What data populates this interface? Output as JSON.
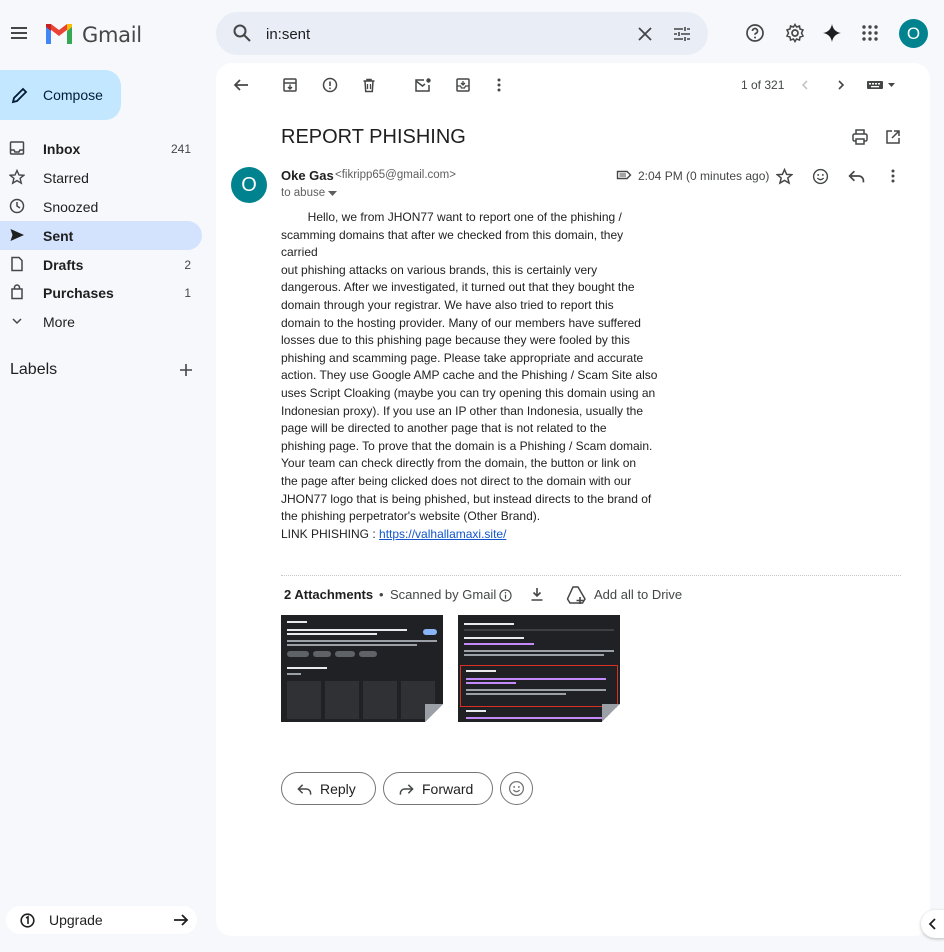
{
  "app": {
    "logo_text": "Gmail"
  },
  "search": {
    "query": "in:sent"
  },
  "account": {
    "initial": "O"
  },
  "sidebar": {
    "compose_label": "Compose",
    "items": [
      {
        "label": "Inbox",
        "count": "241",
        "icon": "inbox-icon"
      },
      {
        "label": "Starred",
        "count": "",
        "icon": "star-icon"
      },
      {
        "label": "Snoozed",
        "count": "",
        "icon": "clock-icon"
      },
      {
        "label": "Sent",
        "count": "",
        "icon": "send-icon",
        "active": true
      },
      {
        "label": "Drafts",
        "count": "2",
        "icon": "file-icon"
      },
      {
        "label": "Purchases",
        "count": "1",
        "icon": "bag-icon"
      },
      {
        "label": "More",
        "count": "",
        "icon": "chevron-down-icon"
      }
    ],
    "labels_title": "Labels",
    "upgrade_label": "Upgrade"
  },
  "toolbar": {
    "pager": "1 of 321"
  },
  "message": {
    "subject": "REPORT PHISHING",
    "sender_name": "Oke Gas",
    "sender_email": "<fikripp65@gmail.com>",
    "sender_initial": "O",
    "to_line": "to abuse",
    "timestamp": "2:04 PM (0 minutes ago)",
    "body": "        Hello, we from JHON77 want to report one of the phishing /\nscamming domains that after we checked from this domain, they carried\nout phishing attacks on various brands, this is certainly very\ndangerous. After we investigated, it turned out that they bought the\ndomain through your registrar. We have also tried to report this\ndomain to the hosting provider. Many of our members have suffered\nlosses due to this phishing page because they were fooled by this\nphishing and scamming page. Please take appropriate and accurate\naction. They use Google AMP cache and the Phishing / Scam Site also\nuses Script Cloaking (maybe you can try opening this domain using an\nIndonesian proxy). If you use an IP other than Indonesia, usually the\npage will be directed to another page that is not related to the\nphishing page. To prove that the domain is a Phishing / Scam domain.\nYour team can check directly from the domain, the button or link on\nthe page after being clicked does not direct to the domain with our\nJHON77 logo that is being phished, but instead directs to the brand of\nthe phishing perpetrator's website (Other Brand).",
    "link_prefix": "LINK PHISHING : ",
    "link_text": "https://valhallamaxi.site/"
  },
  "attachments": {
    "title": "2 Attachments",
    "separator": "•",
    "scanned": "Scanned by Gmail",
    "add_drive": "Add all to Drive"
  },
  "actions": {
    "reply": "Reply",
    "forward": "Forward"
  },
  "colors": {
    "accent": "#c2e7ff",
    "active_nav": "#d3e3fd",
    "avatar": "#00838f",
    "link": "#1155cc"
  }
}
